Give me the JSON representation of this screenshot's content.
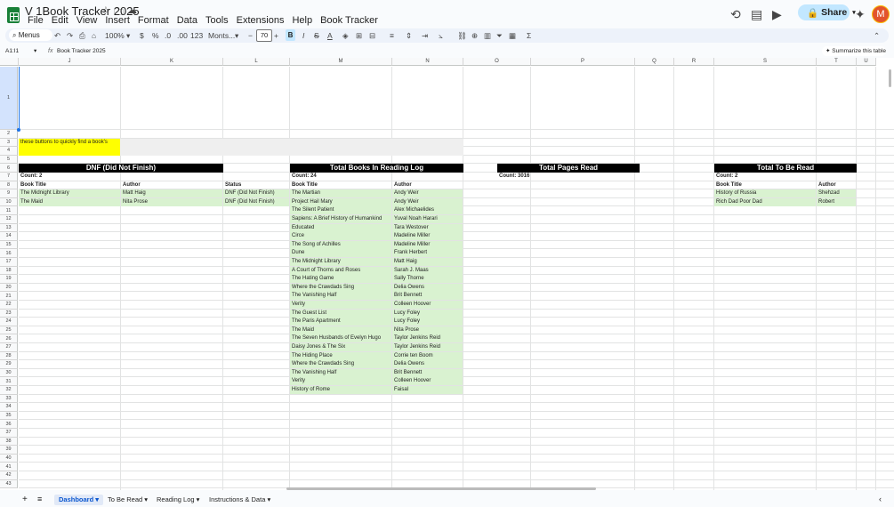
{
  "doc": {
    "title": "V 1Book Tracker 2025"
  },
  "menu": [
    "File",
    "Edit",
    "View",
    "Insert",
    "Format",
    "Data",
    "Tools",
    "Extensions",
    "Help",
    "Book Tracker"
  ],
  "share": {
    "label": "Share"
  },
  "avatar": {
    "letter": "M"
  },
  "toolbar": {
    "search": "Menus",
    "zoom": "100%",
    "currency": "$",
    "percent": "%",
    "dec_less": ".0",
    "dec_more": ".00",
    "number_format": "123",
    "font": "Monts...",
    "font_size": "70",
    "bold": "B",
    "italic": "I",
    "strike": "S",
    "text_color": "A"
  },
  "formula": {
    "cell_ref": "A1:I1",
    "fx": "fx",
    "value": "Book Tracker 2025",
    "summarize": "Summarize this table"
  },
  "columns": [
    "J",
    "K",
    "L",
    "M",
    "N",
    "O",
    "P",
    "Q",
    "R",
    "S",
    "T",
    "U"
  ],
  "rows": [
    "1",
    "2",
    "3",
    "4",
    "5",
    "6",
    "7",
    "8",
    "9",
    "10",
    "11",
    "12",
    "13",
    "14",
    "15",
    "16",
    "17",
    "18",
    "19",
    "20",
    "21",
    "22",
    "23",
    "24",
    "25",
    "26",
    "27",
    "28",
    "29",
    "30",
    "31",
    "32",
    "33",
    "34",
    "35",
    "36",
    "37",
    "38",
    "39",
    "40",
    "41",
    "42",
    "43"
  ],
  "note": "these buttons to quickly find a book's",
  "dnf": {
    "title": "DNF (Did Not Finish)",
    "count": "Count: 2",
    "headers": [
      "Book Title",
      "Author",
      "Status"
    ],
    "rows": [
      [
        "The Midnight Library",
        "Matt Haig",
        "DNF (Did Not Finish)"
      ],
      [
        "The Maid",
        "Nita Prose",
        "DNF (Did Not Finish)"
      ]
    ]
  },
  "log": {
    "title": "Total Books In Reading Log",
    "count": "Count: 24",
    "headers": [
      "Book Title",
      "Author"
    ],
    "rows": [
      [
        "The Martian",
        "Andy Weir"
      ],
      [
        "Project Hail Mary",
        "Andy Weir"
      ],
      [
        "The Silent Patient",
        "Alex Michaelides"
      ],
      [
        "Sapiens: A Brief History of Humankind",
        "Yuval Noah Harari"
      ],
      [
        "Educated",
        "Tara Westover"
      ],
      [
        "Circe",
        "Madeline Miller"
      ],
      [
        "The Song of Achilles",
        "Madeline Miller"
      ],
      [
        "Dune",
        "Frank Herbert"
      ],
      [
        "The Midnight Library",
        "Matt Haig"
      ],
      [
        "A Court of Thorns and Roses",
        "Sarah J. Maas"
      ],
      [
        "The Hating Game",
        "Sally Thorne"
      ],
      [
        "Where the Crawdads Sing",
        "Delia Owens"
      ],
      [
        "The Vanishing Half",
        "Brit Bennett"
      ],
      [
        "Verity",
        "Colleen Hoover"
      ],
      [
        "The Guest List",
        "Lucy Foley"
      ],
      [
        "The Paris Apartment",
        "Lucy Foley"
      ],
      [
        "The Maid",
        "Nita Prose"
      ],
      [
        "The Seven Husbands of Evelyn Hugo",
        "Taylor Jenkins Reid"
      ],
      [
        "Daisy Jones & The Six",
        "Taylor Jenkins Reid"
      ],
      [
        "The Hiding Place",
        "Corrie ten Boom"
      ],
      [
        "Where the Crawdads Sing",
        "Delia Owens"
      ],
      [
        "The Vanishing Half",
        "Brit Bennett"
      ],
      [
        "Verity",
        "Colleen Hoover"
      ],
      [
        "History of Rome",
        "Faisal"
      ]
    ]
  },
  "pages": {
    "title": "Total Pages Read",
    "count": "Count: 3016"
  },
  "tbr": {
    "title": "Total To Be Read",
    "count": "Count: 2",
    "headers": [
      "Book Title",
      "Author"
    ],
    "rows": [
      [
        "History of Russia",
        "Shehzad"
      ],
      [
        "Rich Dad Poor Dad",
        "Robert"
      ]
    ]
  },
  "sheets": [
    "Dashboard",
    "To Be Read",
    "Reading Log",
    "Instructions & Data"
  ]
}
